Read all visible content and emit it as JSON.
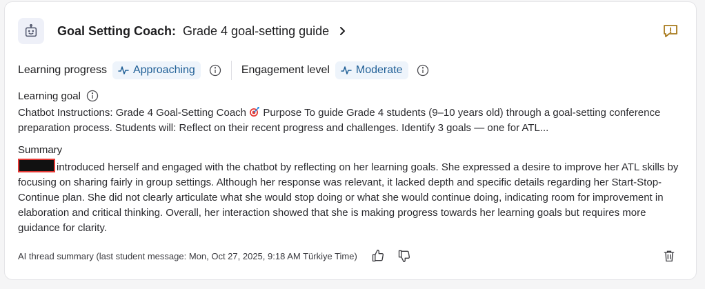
{
  "header": {
    "title": "Goal Setting Coach:",
    "subtitle": "Grade 4 goal-setting guide",
    "icons": {
      "bot": "robot-icon",
      "chevron": "chevron-right-icon",
      "report": "report-icon"
    }
  },
  "metrics": {
    "learning_progress_label": "Learning progress",
    "learning_progress_value": "Approaching",
    "engagement_label": "Engagement level",
    "engagement_value": "Moderate"
  },
  "goal": {
    "label": "Learning goal",
    "text_part1": "Chatbot Instructions: Grade 4 Goal-Setting Coach ",
    "text_part2": " Purpose To guide Grade 4 students (9–10 years old) through a goal-setting conference preparation process. Students will: Reflect on their recent progress and challenges. Identify 3 goals — one for ATL..."
  },
  "summary": {
    "label": "Summary",
    "text": "introduced herself and engaged with the chatbot by reflecting on her learning goals. She expressed a desire to improve her ATL skills by focusing on sharing fairly in group settings. Although her response was relevant, it lacked depth and specific details regarding her Start-Stop-Continue plan. She did not clearly articulate what she would stop doing or what she would continue doing, indicating room for improvement in elaboration and critical thinking. Overall, her interaction showed that she is making progress towards her learning goals but requires more guidance for clarity."
  },
  "footer": {
    "meta": "AI thread summary (last student message: Mon, Oct 27, 2025, 9:18 AM Türkiye Time)"
  },
  "colors": {
    "accent": "#1f5f96",
    "pill_bg": "#eef4fb",
    "report": "#a8791b",
    "redact_border": "#e53935"
  }
}
